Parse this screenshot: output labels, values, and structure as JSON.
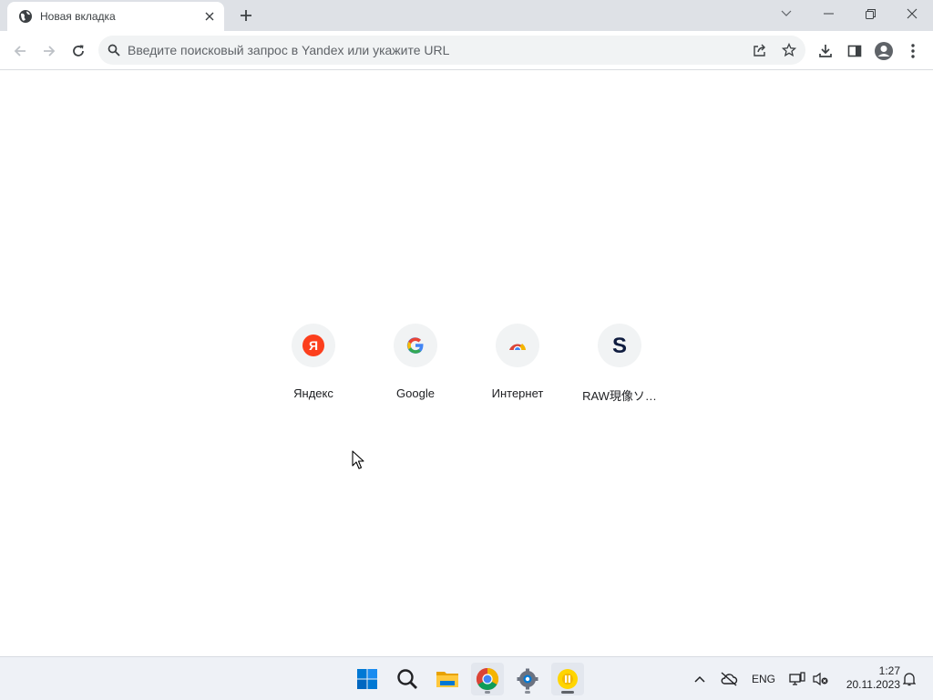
{
  "browser": {
    "tab": {
      "title": "Новая вкладка"
    },
    "omnibox": {
      "placeholder": "Введите поисковый запрос в Yandex или укажите URL",
      "value": ""
    }
  },
  "shortcuts": [
    {
      "label": "Яндекс",
      "icon": "yandex-icon",
      "glyph": "Я",
      "color": "#fc3f1d"
    },
    {
      "label": "Google",
      "icon": "google-icon",
      "glyph": "G",
      "color": "#4285f4"
    },
    {
      "label": "Интернет",
      "icon": "chrome-icon",
      "glyph": "",
      "color": "#db4437"
    },
    {
      "label": "RAW現像ソ…",
      "icon": "s-logo-icon",
      "glyph": "S",
      "color": "#0f1c3f"
    }
  ],
  "taskbar": {
    "apps": [
      "windows-start-icon",
      "search-icon",
      "file-explorer-icon",
      "chrome-icon",
      "settings-icon",
      "yellow-app-icon"
    ],
    "language": "ENG",
    "time": "1:27",
    "date": "20.11.2023"
  },
  "colors": {
    "tabstrip": "#dee1e6",
    "omnibox": "#f1f3f4",
    "taskbar": "#eef1f6",
    "accent": "#0067c0"
  }
}
